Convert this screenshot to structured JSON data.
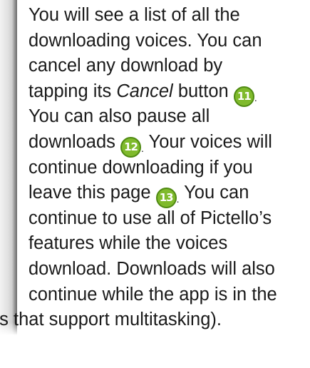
{
  "lines": [
    "You will see a list of all the",
    "downloading voices. You can",
    "cancel any download by"
  ],
  "line4": {
    "before": "tapping its ",
    "italic": "Cancel",
    "after": " button ",
    "badge": "11",
    "dot": "."
  },
  "line5": "You can also pause all",
  "line6": {
    "before": "downloads ",
    "badge": "12",
    "dot": ".",
    "after": " Your voices will"
  },
  "line7": "continue downloading if you",
  "line8": {
    "before": "leave this page ",
    "badge": "13",
    "dot": ".",
    "after": " You can"
  },
  "lines_b": [
    "continue to use all of Pictello’s",
    "features while the voices",
    "download. Downloads will also",
    "continue while the app is in the"
  ],
  "line13": "es that support multitasking).",
  "badge_color": "#7fba2c"
}
